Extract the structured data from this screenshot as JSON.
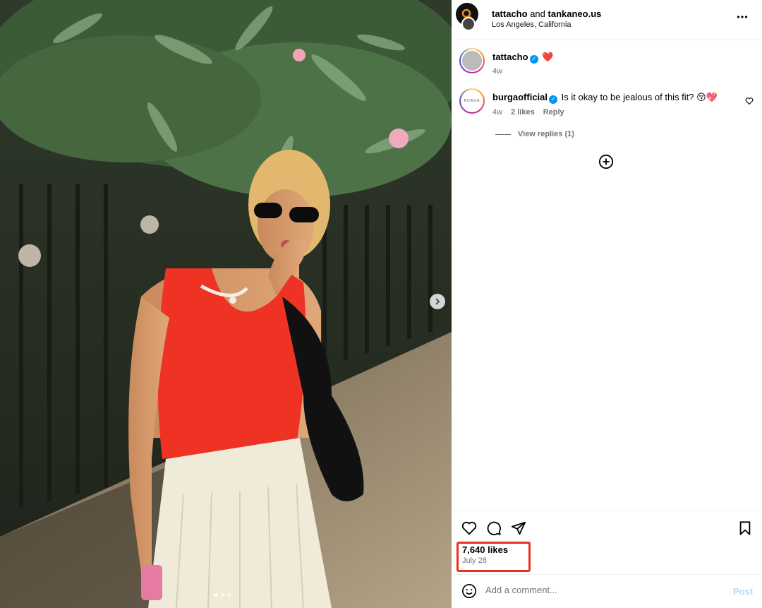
{
  "post": {
    "authors_primary": "tattacho",
    "authors_joiner": "and",
    "authors_secondary": "tankaneo.us",
    "location": "Los Angeles, California",
    "more_icon": "more-horizontal-icon"
  },
  "comments": [
    {
      "username": "tattacho",
      "verified": true,
      "text": "❤️",
      "time": "4w"
    },
    {
      "username": "burgaofficial",
      "verified": true,
      "text": "Is it okay to be jealous of this fit? 😚💖",
      "time": "4w",
      "likes": "2 likes",
      "reply_label": "Reply",
      "avatar_text": "BURGA",
      "view_replies": "View replies (1)"
    }
  ],
  "stats": {
    "likes": "7,640 likes",
    "date": "July 28"
  },
  "composer": {
    "placeholder": "Add a comment...",
    "post_label": "Post"
  },
  "colors": {
    "verified": "#0095f6",
    "highlight_box": "#e8321e",
    "post_disabled": "#b3dbff",
    "secondary_text": "#737373"
  }
}
